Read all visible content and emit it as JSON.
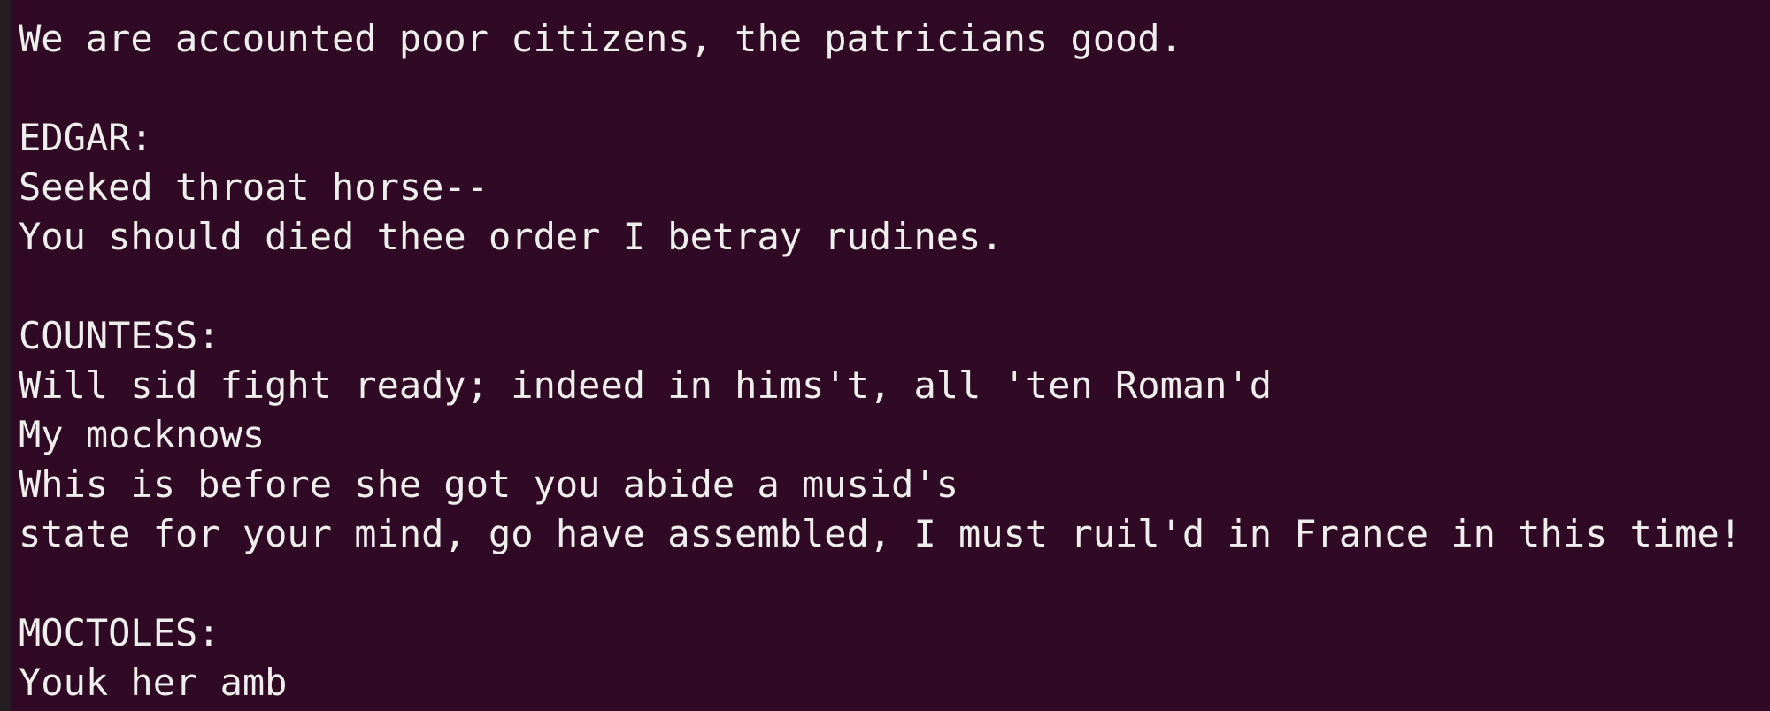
{
  "terminal": {
    "lines": [
      "",
      "We are accounted poor citizens, the patricians good.",
      "",
      "EDGAR:",
      "Seeked throat horse--",
      "You should died thee order I betray rudines.",
      "",
      "COUNTESS:",
      "Will sid fight ready; indeed in hims't, all 'ten Roman'd",
      "My mocknows",
      "Whis is before she got you abide a musid's",
      "state for your mind, go have assembled, I must ruil'd in France in this time!",
      "",
      "MOCTOLES:",
      "Youk her amb"
    ]
  }
}
